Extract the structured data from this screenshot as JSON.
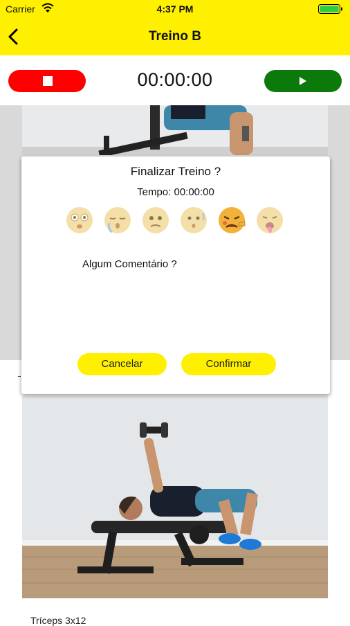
{
  "status_bar": {
    "carrier": "Carrier",
    "time": "4:37 PM"
  },
  "nav": {
    "title": "Treino B"
  },
  "timer": {
    "display": "00:00:00"
  },
  "dialog": {
    "title": "Finalizar Treino ?",
    "time_text": "Tempo: 00:00:00",
    "emojis": [
      "dizzy-emoji",
      "sleepy-emoji",
      "worried-emoji",
      "surprised-emoji",
      "exhausted-emoji",
      "nauseated-emoji"
    ],
    "comment_label": "Algum Comentário ?",
    "cancel_label": "Cancelar",
    "confirm_label": "Confirmar"
  },
  "below": {
    "text": "Tríceps 3x12"
  },
  "colors": {
    "brand_yellow": "#ffef00",
    "stop_red": "#ff0000",
    "play_green": "#0b7a0b"
  }
}
